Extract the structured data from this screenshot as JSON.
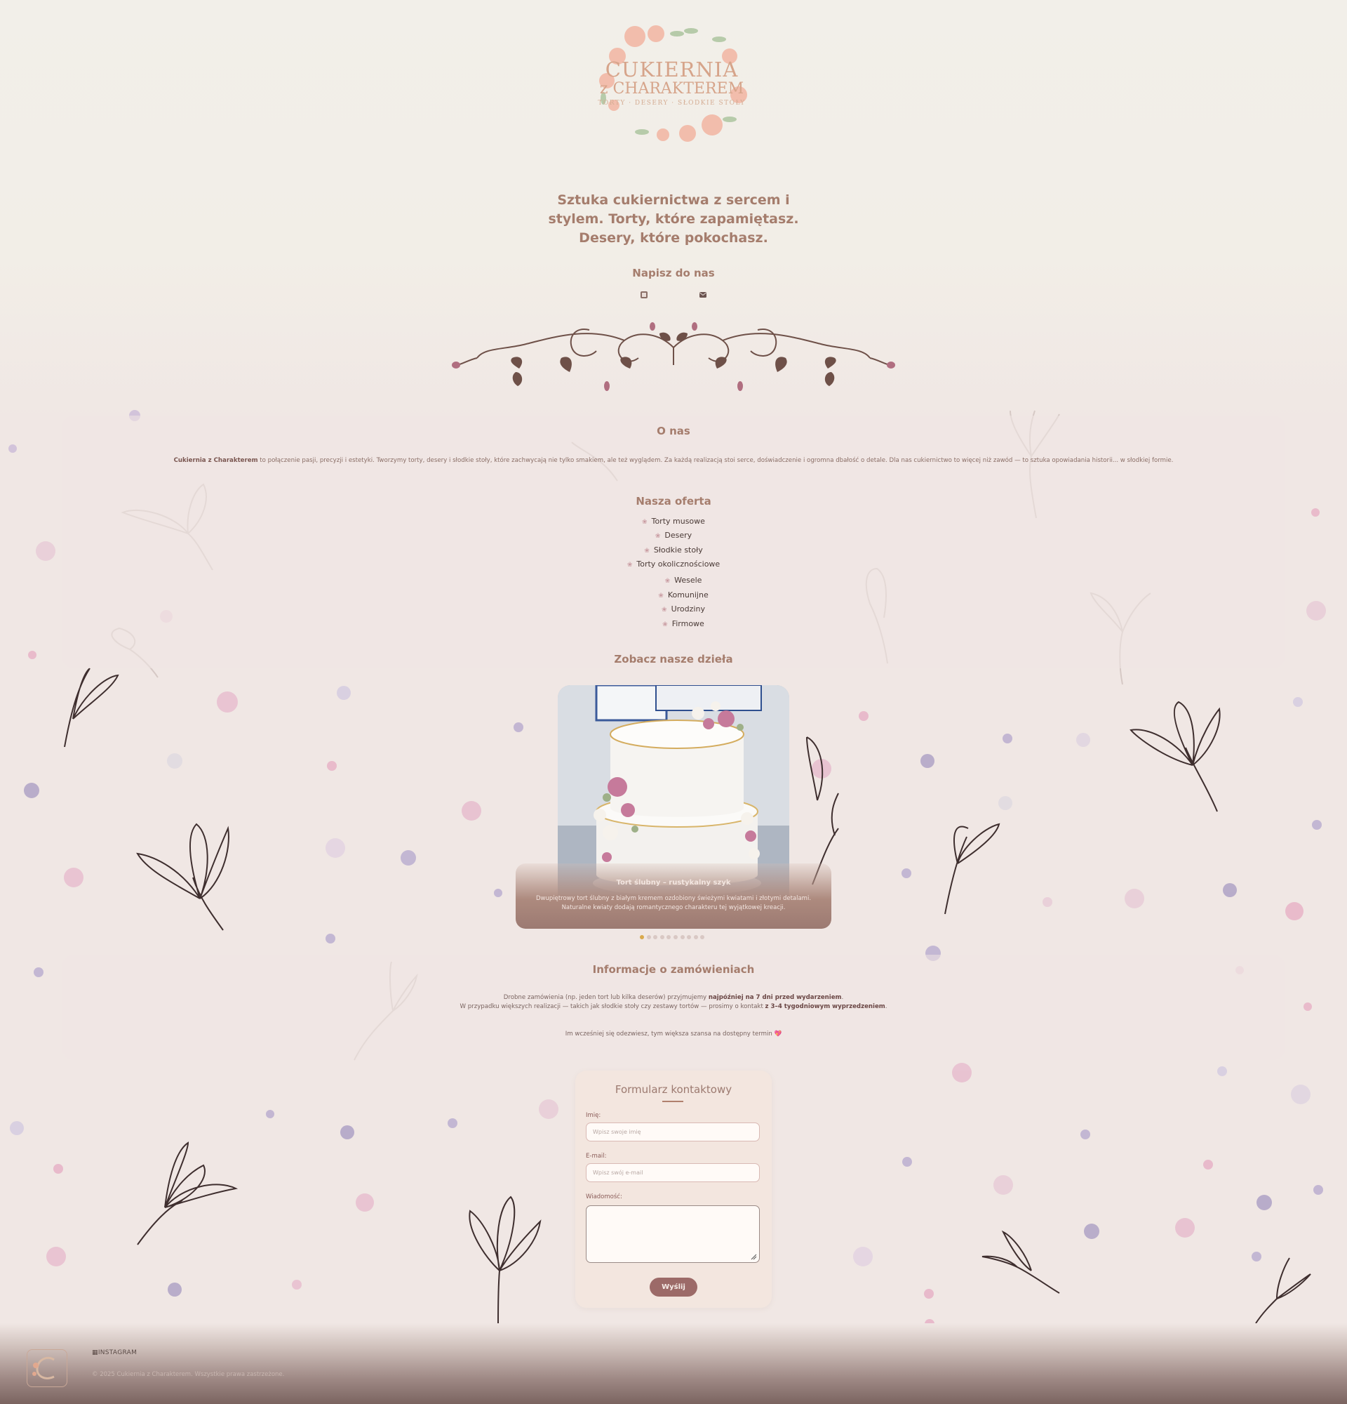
{
  "logo": {
    "line1": "CUKIERNIA",
    "line2": "z CHARAKTEREM",
    "line3": "TORTY · DESERY · SŁODKIE STOŁY"
  },
  "hero": {
    "tagline": "Sztuka cukiernictwa z sercem i stylem. Torty, które zapamiętasz. Desery, które pokochasz.",
    "contact_heading": "Napisz do nas",
    "contact_icons": [
      "phone-icon",
      "mail-icon"
    ]
  },
  "about": {
    "title": "O nas",
    "brand": "Cukiernia z Charakterem",
    "text": " to połączenie pasji, precyzji i estetyki. Tworzymy torty, desery i słodkie stoły, które zachwycają nie tylko smakiem, ale też wyglądem. Za każdą realizacją stoi serce, doświadczenie i ogromna dbałość o detale. Dla nas cukiernictwo to więcej niż zawód — to sztuka opowiadania historii... w słodkiej formie."
  },
  "offer": {
    "title": "Nasza oferta",
    "items": [
      "Torty musowe",
      "Desery",
      "Słodkie stoły",
      "Torty okolicznościowe"
    ],
    "subitems": [
      "Wesele",
      "Komunijne",
      "Urodziny",
      "Firmowe"
    ]
  },
  "gallery": {
    "title": "Zobacz nasze dzieła",
    "caption_title": "Tort ślubny – rustykalny szyk",
    "caption_desc": "Dwupiętrowy tort ślubny z białym kremem ozdobiony świeżymi kwiatami i złotymi detalami. Naturalne kwiaty dodają romantycznego charakteru tej wyjątkowej kreacji.",
    "slide_count": 10,
    "active_slide": 1
  },
  "info": {
    "title": "Informacje o zamówieniach",
    "line1_pre": "Drobne zamówienia (np. jeden tort lub kilka deserów) przyjmujemy ",
    "line1_bold": "najpóźniej na 7 dni przed wydarzeniem",
    "line1_post": ".",
    "line2_pre": "W przypadku większych realizacji — takich jak słodkie stoły czy zestawy tortów — prosimy o kontakt ",
    "line2_bold": "z 3–4 tygodniowym wyprzedzeniem",
    "line2_post": ".",
    "line3": "Im wcześniej się odezwiesz, tym większa szansa na dostępny termin 💖"
  },
  "form": {
    "title": "Formularz kontaktowy",
    "name_label": "Imię:",
    "name_placeholder": "Wpisz swoje imię",
    "email_label": "E-mail:",
    "email_placeholder": "Wpisz swój e-mail",
    "message_label": "Wiadomość:",
    "submit_label": "Wyślij"
  },
  "footer": {
    "instagram_label": "INSTAGRAM",
    "copyright": "© 2025 Cukiernia z Charakterem. Wszystkie prawa zastrzeżone."
  },
  "colors": {
    "accent": "#a57d6d",
    "button": "#9c6a68",
    "active_dot": "#d9a94c"
  }
}
